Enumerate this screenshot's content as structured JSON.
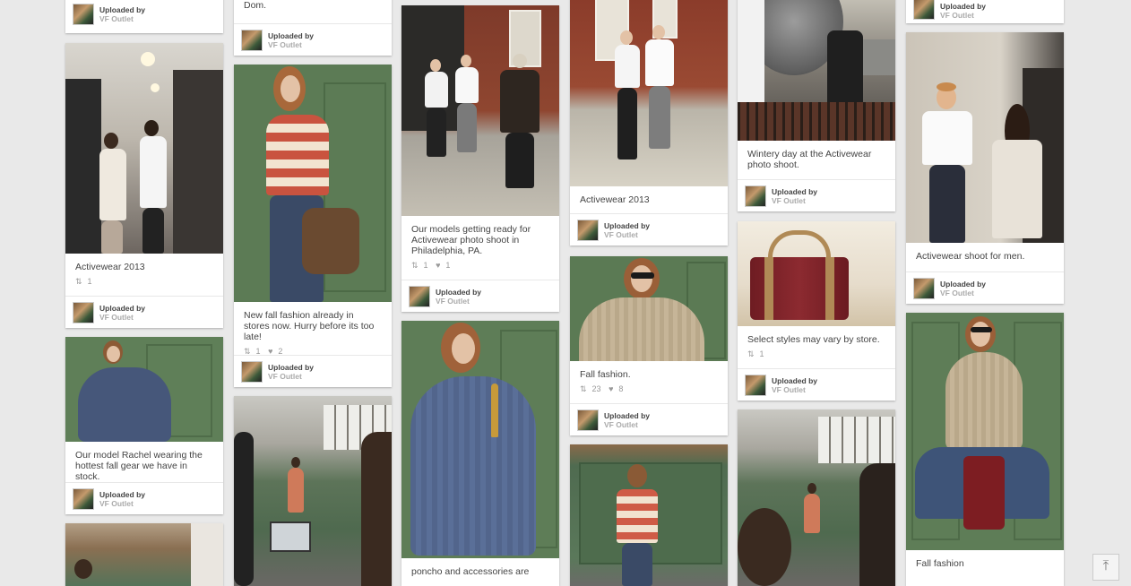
{
  "uploader": {
    "label": "Uploaded by",
    "name": "VF Outlet"
  },
  "pins": {
    "c1_top": {},
    "c1_p1": {
      "desc": "Activewear 2013",
      "repins": "1"
    },
    "c1_p2": {
      "desc": "Our model Rachel wearing the hottest fall gear we have in stock."
    },
    "c2_top": {
      "desc": "Dom."
    },
    "c2_p1": {
      "desc": "New fall fashion already in stores now. Hurry before its too late!",
      "repins": "1",
      "likes": "2"
    },
    "c3_p1": {
      "desc": "Our models getting ready for Activewear photo shoot in Philadelphia, PA.",
      "repins": "1",
      "likes": "1"
    },
    "c3_p2": {
      "desc": "poncho and accessories are"
    },
    "c4_p1": {
      "desc": "Activewear 2013"
    },
    "c4_p2": {
      "desc": "Fall fashion.",
      "repins": "23",
      "likes": "8"
    },
    "c5_p1": {
      "desc": "Wintery day at the Activewear photo shoot."
    },
    "c5_p2": {
      "desc": "Select styles may vary by store.",
      "repins": "1"
    },
    "c6_top": {},
    "c6_p1": {
      "desc": "Activewear shoot for men."
    },
    "c6_p2": {
      "desc": "Fall fashion"
    }
  },
  "icons": {
    "repin": "repin-icon",
    "like": "heart-icon",
    "scroll_top": "arrow-up-to-top-icon"
  },
  "colors": {
    "background": "#e9e9e9",
    "door_green": "#5e7d57",
    "card": "#ffffff"
  }
}
